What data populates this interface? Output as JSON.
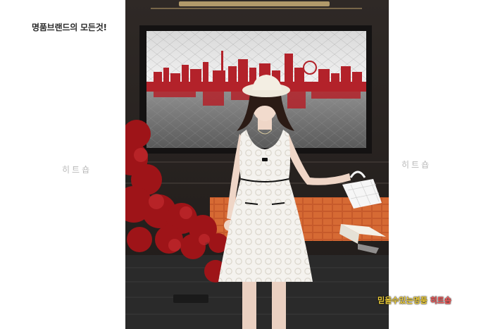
{
  "caption": "명품브랜드의 모든것!",
  "watermark_left": "히트숍",
  "watermark_right": "히트숍",
  "badge": {
    "part1": "믿을수있는명품",
    "part2": "히트숍"
  },
  "colors": {
    "wall": "#2a2522",
    "skyline_red": "#b3222a",
    "dress": "#f3f1ec",
    "flowers": "#9e1418",
    "orange_tile": "#c2582a",
    "badge_yellow": "#f2d13a",
    "badge_red": "#ff5a5a"
  }
}
